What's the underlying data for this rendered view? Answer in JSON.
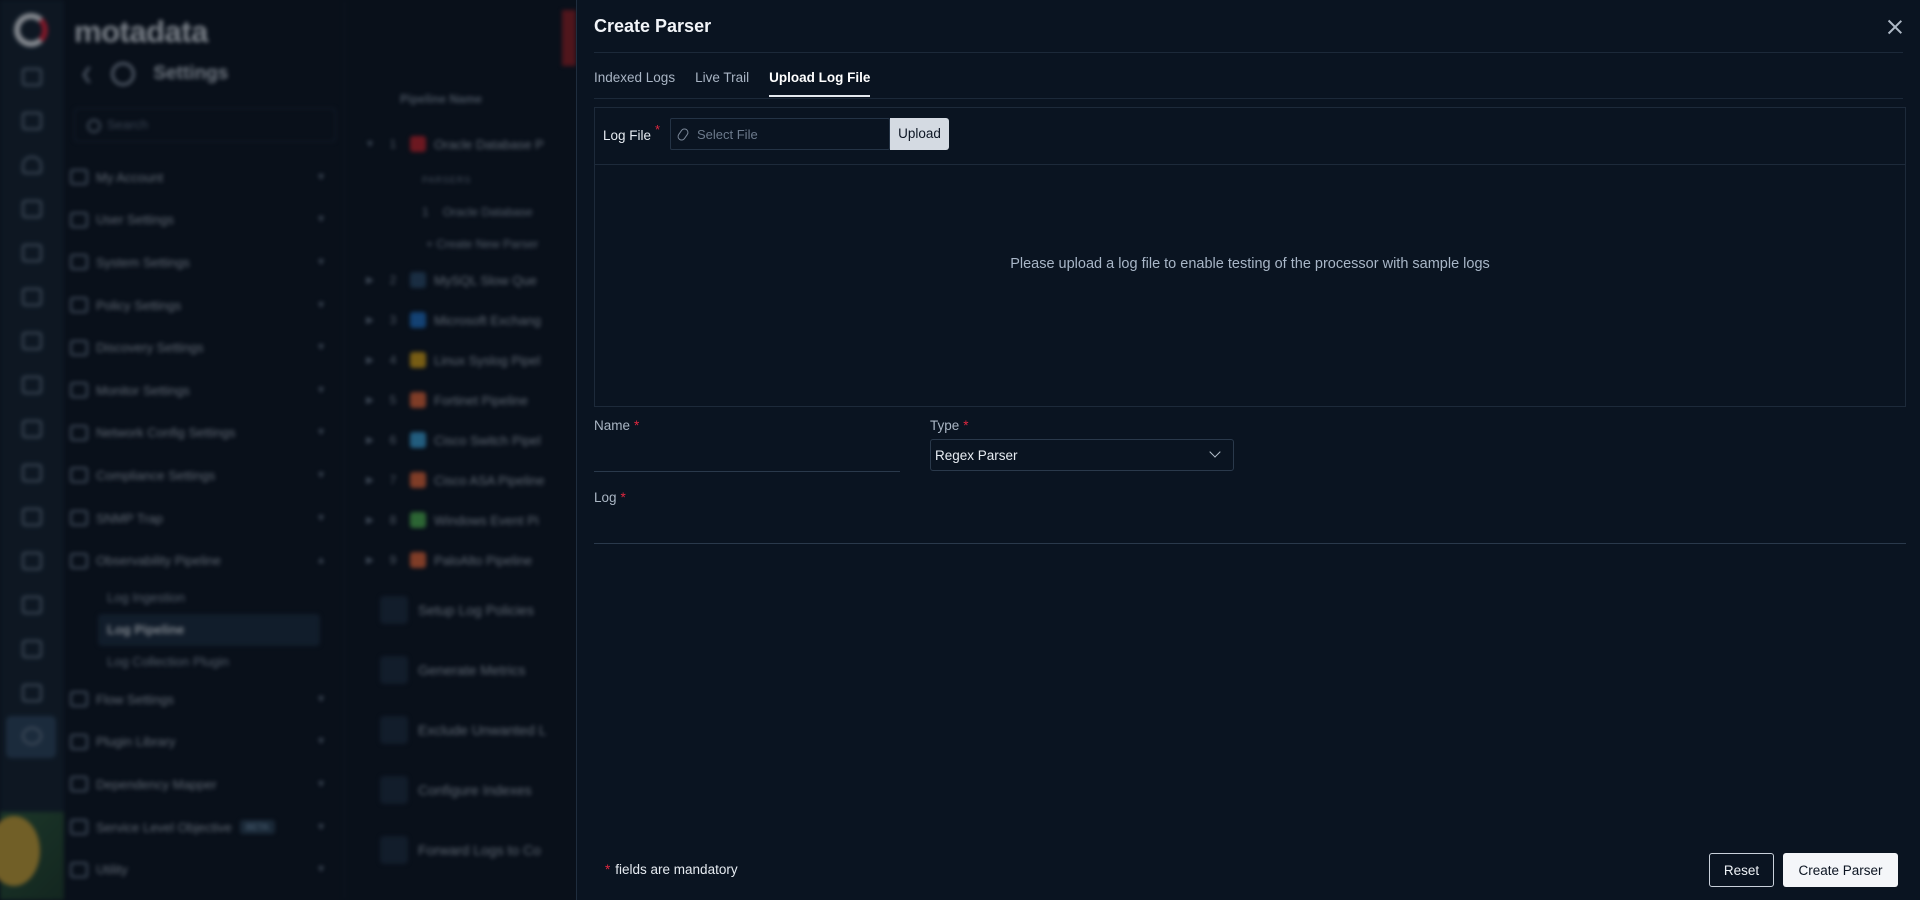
{
  "background": {
    "brand": "motadata",
    "settings_title": "Settings",
    "search_placeholder": "Search",
    "menu": [
      {
        "label": "My Account"
      },
      {
        "label": "User Settings"
      },
      {
        "label": "System Settings"
      },
      {
        "label": "Policy Settings"
      },
      {
        "label": "Discovery Settings"
      },
      {
        "label": "Monitor Settings"
      },
      {
        "label": "Network Config Settings"
      },
      {
        "label": "Compliance Settings"
      },
      {
        "label": "SNMP Trap"
      },
      {
        "label": "Observability Pipeline"
      }
    ],
    "submenu": [
      "Log Ingestion",
      "Log Pipeline",
      "Log Collection Plugin"
    ],
    "menu_after": [
      {
        "label": "Flow Settings"
      },
      {
        "label": "Plugin Library"
      },
      {
        "label": "Dependency Mapper"
      },
      {
        "label": "Service Level Objective",
        "badge": "BETA"
      },
      {
        "label": "Utility"
      }
    ],
    "pipeline_header": "Pipeline Name",
    "pipelines": [
      {
        "num": "1",
        "name": "Oracle Database P",
        "color": "#c0242e"
      },
      {
        "num": "2",
        "name": "MySQL Slow Que",
        "color": "#2a4a6b"
      },
      {
        "num": "3",
        "name": "Microsoft Exchang",
        "color": "#1f6fc4"
      },
      {
        "num": "4",
        "name": "Linux Syslog Pipel",
        "color": "#d4a017"
      },
      {
        "num": "5",
        "name": "Fortinet Pipeline",
        "color": "#e2663a"
      },
      {
        "num": "6",
        "name": "Cisco Switch Pipel",
        "color": "#3aa0d8"
      },
      {
        "num": "7",
        "name": "Cisco ASA Pipeline",
        "color": "#e2663a"
      },
      {
        "num": "8",
        "name": "Windows Event Pi",
        "color": "#4caf50"
      },
      {
        "num": "9",
        "name": "PaloAlto Pipeline",
        "color": "#e2663a"
      }
    ],
    "pipeline_sub": {
      "tag": "PARSERS",
      "item_num": "1",
      "item": "Oracle Database",
      "create": "+ Create New Parser"
    },
    "stages": [
      "Setup Log Policies",
      "Generate Metrics",
      "Exclude Unwanted L",
      "Configure Indexes",
      "Forward Logs to Co"
    ]
  },
  "drawer": {
    "title": "Create Parser",
    "tabs": [
      {
        "label": "Indexed Logs",
        "active": false
      },
      {
        "label": "Live Trail",
        "active": false
      },
      {
        "label": "Upload Log File",
        "active": true
      }
    ],
    "upload": {
      "label": "Log File",
      "required_mark": "*",
      "placeholder": "Select File",
      "button": "Upload",
      "message": "Please upload a log file to enable testing of the processor with sample logs"
    },
    "form": {
      "name_label": "Name",
      "name_value": "",
      "type_label": "Type",
      "type_value": "Regex Parser",
      "log_label": "Log",
      "log_value": "",
      "required_mark": "*"
    },
    "footer": {
      "mandatory_mark": "*",
      "mandatory_note": "fields are mandatory",
      "reset": "Reset",
      "create": "Create Parser"
    }
  },
  "colors": {
    "background": "#0b1421",
    "drawer": "#0a1421",
    "required": "#e0273f",
    "primary_button": "#f4f6f9"
  }
}
